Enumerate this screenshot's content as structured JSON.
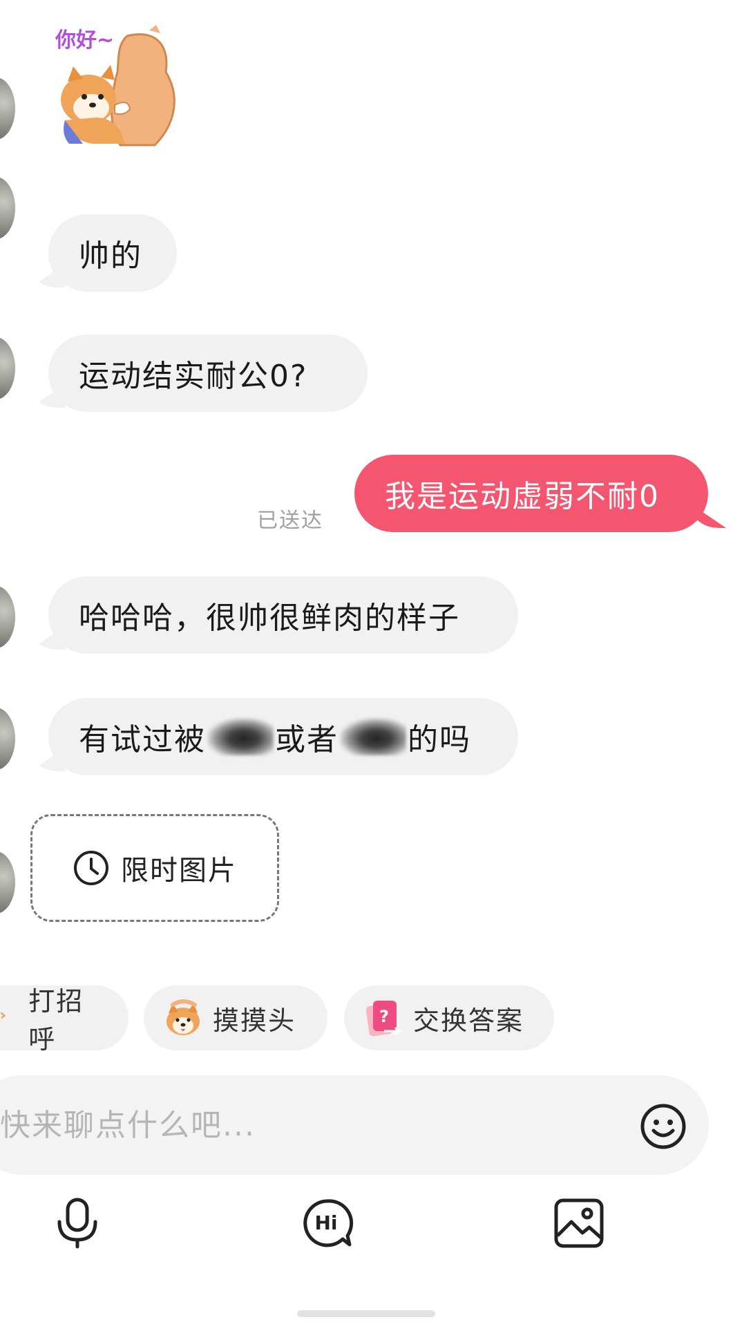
{
  "sticker": {
    "caption": "你好~"
  },
  "messages": [
    {
      "text": "帅的"
    },
    {
      "text": "运动结实耐公0?"
    },
    {
      "text": "我是运动虚弱不耐0",
      "status": "已送达"
    },
    {
      "text": "哈哈哈，很帅很鲜肉的样子"
    },
    {
      "parts": [
        "有试过被",
        "或者",
        "的吗"
      ]
    }
  ],
  "timed_picture": {
    "label": "限时图片"
  },
  "quick_actions": [
    {
      "label": "打招呼",
      "icon": "wave-icon"
    },
    {
      "label": "摸摸头",
      "icon": "shiba-pat-icon"
    },
    {
      "label": "交换答案",
      "icon": "question-card-icon"
    }
  ],
  "composer": {
    "placeholder": "快来聊点什么吧..."
  },
  "toolbar": {
    "icons": [
      "microphone-icon",
      "hi-icon",
      "image-icon"
    ]
  },
  "colors": {
    "sent_bubble": "#f4566f",
    "received_bubble": "#f1f1f1",
    "status_text": "#a0a0a0"
  }
}
